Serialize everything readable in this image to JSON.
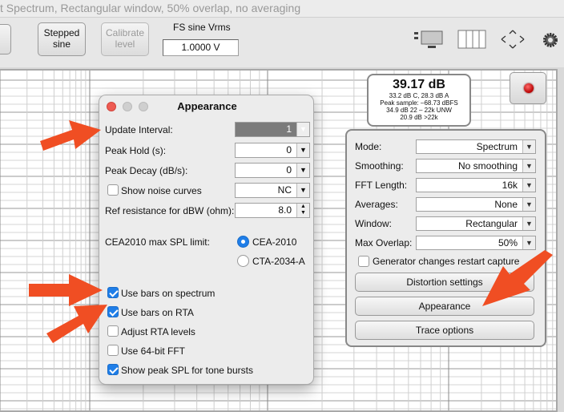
{
  "window": {
    "title": "t Spectrum, Rectangular window, 50% overlap, no averaging"
  },
  "toolbar": {
    "stepped_sine_label": "Stepped sine",
    "calibrate_level_label": "Calibrate level",
    "fs_label": "FS sine Vrms",
    "fs_value": "1.0000 V"
  },
  "readout": {
    "main": "39.17 dB",
    "lines": [
      "33.2 dB C, 28.3 dB A",
      "Peak sample: –68.73 dBFS",
      "34.9 dB 22 – 22k UNW",
      "20.9 dB >22k"
    ]
  },
  "panel": {
    "mode_label": "Mode:",
    "mode_value": "Spectrum",
    "smoothing_label": "Smoothing:",
    "smoothing_value": "No  smoothing",
    "fft_label": "FFT Length:",
    "fft_value": "16k",
    "averages_label": "Averages:",
    "averages_value": "None",
    "window_label": "Window:",
    "window_value": "Rectangular",
    "overlap_label": "Max Overlap:",
    "overlap_value": "50%",
    "generator_label": "Generator changes restart capture",
    "distortion_button": "Distortion settings",
    "appearance_button": "Appearance",
    "trace_button": "Trace options"
  },
  "dialog": {
    "title": "Appearance",
    "update_interval_label": "Update Interval:",
    "update_interval_value": "1",
    "peak_hold_label": "Peak Hold (s):",
    "peak_hold_value": "0",
    "peak_decay_label": "Peak Decay (dB/s):",
    "peak_decay_value": "0",
    "noise_curves_label": "Show noise curves",
    "noise_curves_value": "NC",
    "ref_res_label": "Ref resistance for dBW (ohm):",
    "ref_res_value": "8.0",
    "cea_label": "CEA2010 max SPL limit:",
    "cea_option1": "CEA-2010",
    "cea_option2": "CTA-2034-A",
    "cb_bars_spectrum": "Use bars on spectrum",
    "cb_bars_rta": "Use bars on RTA",
    "cb_adjust_rta": "Adjust RTA levels",
    "cb_64bit": "Use 64-bit FFT",
    "cb_peak_spl": "Show peak SPL for tone bursts"
  },
  "colors": {
    "accent": "#1f7ee8",
    "arrow": "#f04e23"
  }
}
